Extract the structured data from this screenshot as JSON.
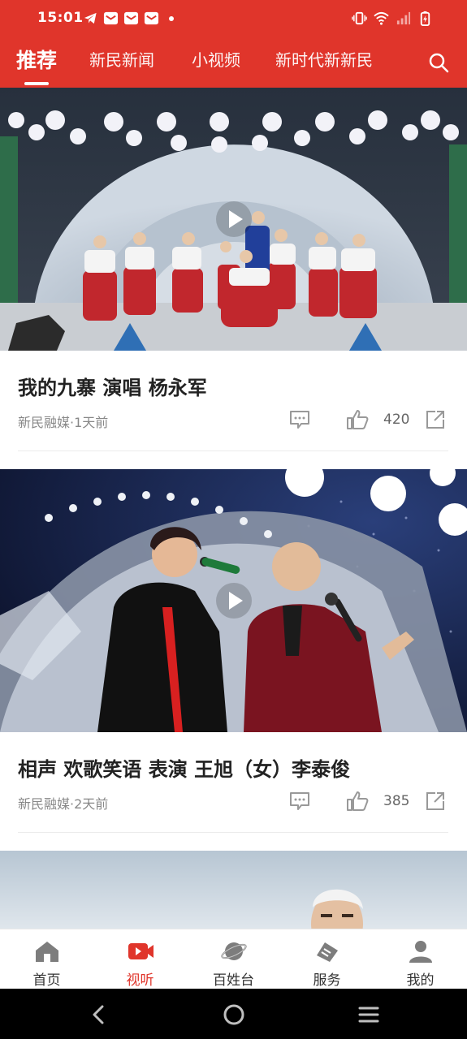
{
  "status_bar": {
    "time": "15:01",
    "left_icons": [
      "telegram-icon",
      "mail-icon",
      "mail-icon",
      "mail-icon"
    ],
    "right_icons": [
      "vibrate-icon",
      "wifi-icon",
      "signal-icon",
      "battery-charging-icon"
    ]
  },
  "header": {
    "tabs": [
      {
        "label": "推荐",
        "active": true
      },
      {
        "label": "新民新闻",
        "active": false
      },
      {
        "label": "小视频",
        "active": false
      },
      {
        "label": "新时代新新民",
        "active": false
      }
    ],
    "search_icon": "search-icon",
    "background_color": "#e0352b"
  },
  "feed": {
    "items": [
      {
        "title": "我的九寨 演唱 杨永军",
        "meta": "新民融媒·1天前",
        "likes": "420"
      },
      {
        "title": "相声 欢歌笑语 表演 王旭（女）李泰俊",
        "meta": "新民融媒·2天前",
        "likes": "385"
      }
    ]
  },
  "bottom_nav": {
    "items": [
      {
        "label": "首页",
        "icon": "home-icon",
        "active": false
      },
      {
        "label": "视听",
        "icon": "video-play-icon",
        "active": true
      },
      {
        "label": "百姓台",
        "icon": "planet-icon",
        "active": false
      },
      {
        "label": "服务",
        "icon": "service-icon",
        "active": false
      },
      {
        "label": "我的",
        "icon": "person-icon",
        "active": false
      }
    ],
    "active_color": "#e0352b"
  },
  "system_nav": [
    "back-icon",
    "home-circle-icon",
    "menu-icon"
  ]
}
